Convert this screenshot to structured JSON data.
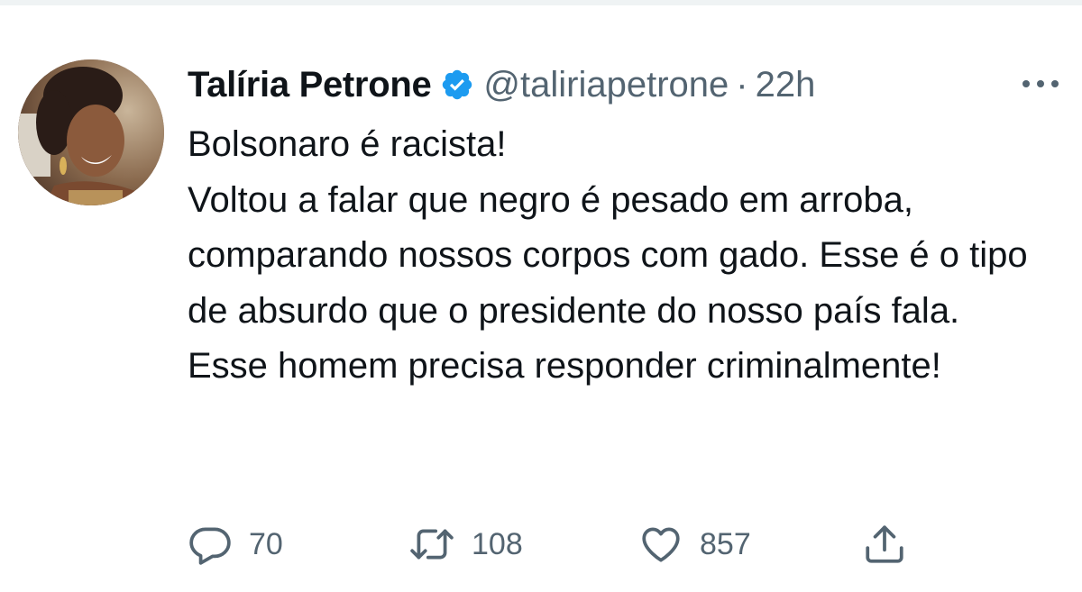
{
  "tweet": {
    "author_name": "Talíria Petrone",
    "handle": "@taliriapetrone",
    "separator": "·",
    "time": "22h",
    "text": "Bolsonaro é racista!\nVoltou a falar que negro é pesado em arroba, comparando nossos corpos com gado. Esse é o tipo de absurdo que o presidente do nosso país fala.\nEsse homem precisa responder criminalmente!",
    "replies": "70",
    "retweets": "108",
    "likes": "857"
  },
  "icons": {
    "verified": "verified-badge-icon",
    "more": "more-options-icon",
    "reply": "reply-icon",
    "retweet": "retweet-icon",
    "like": "like-icon",
    "share": "share-icon"
  },
  "colors": {
    "verified_blue": "#1d9bf0",
    "secondary_text": "#536471",
    "primary_text": "#0f1419"
  }
}
